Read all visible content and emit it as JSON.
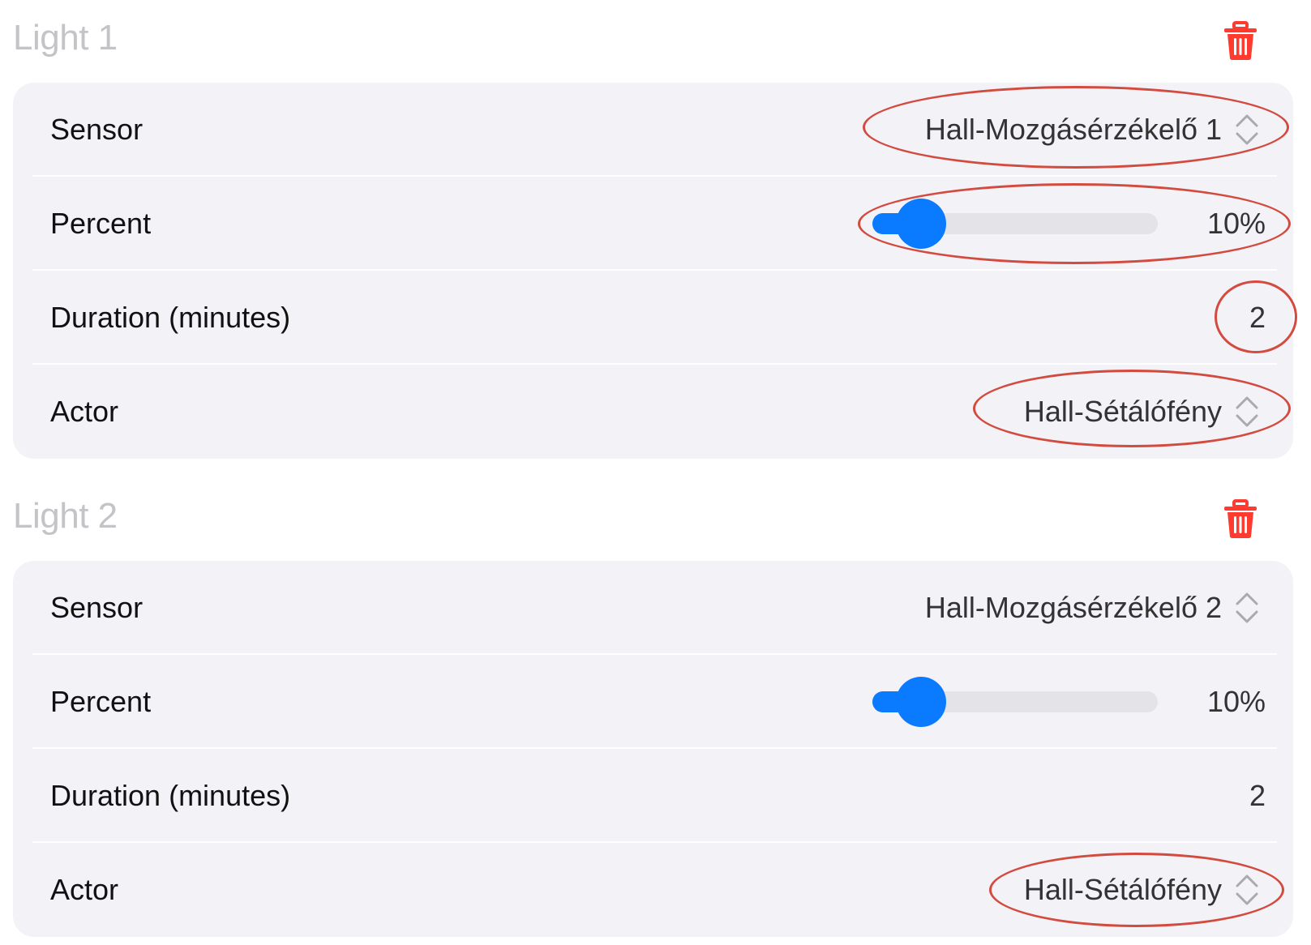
{
  "lights": [
    {
      "title": "Light 1",
      "delete_icon": "trash-icon",
      "sensor": {
        "label": "Sensor",
        "value": "Hall-Mozgásérzékelő 1"
      },
      "percent": {
        "label": "Percent",
        "value": 0.1,
        "value_text": "10%"
      },
      "duration": {
        "label": "Duration (minutes)",
        "value": "2"
      },
      "actor": {
        "label": "Actor",
        "value": "Hall-Sétálófény"
      }
    },
    {
      "title": "Light 2",
      "delete_icon": "trash-icon",
      "sensor": {
        "label": "Sensor",
        "value": "Hall-Mozgásérzékelő 2"
      },
      "percent": {
        "label": "Percent",
        "value": 0.1,
        "value_text": "10%"
      },
      "duration": {
        "label": "Duration (minutes)",
        "value": "2"
      },
      "actor": {
        "label": "Actor",
        "value": "Hall-Sétálófény"
      }
    }
  ],
  "colors": {
    "accent": "#0a7aff",
    "delete": "#ff3b30",
    "annotation": "#d34b3f",
    "card_bg": "#f2f2f7"
  }
}
